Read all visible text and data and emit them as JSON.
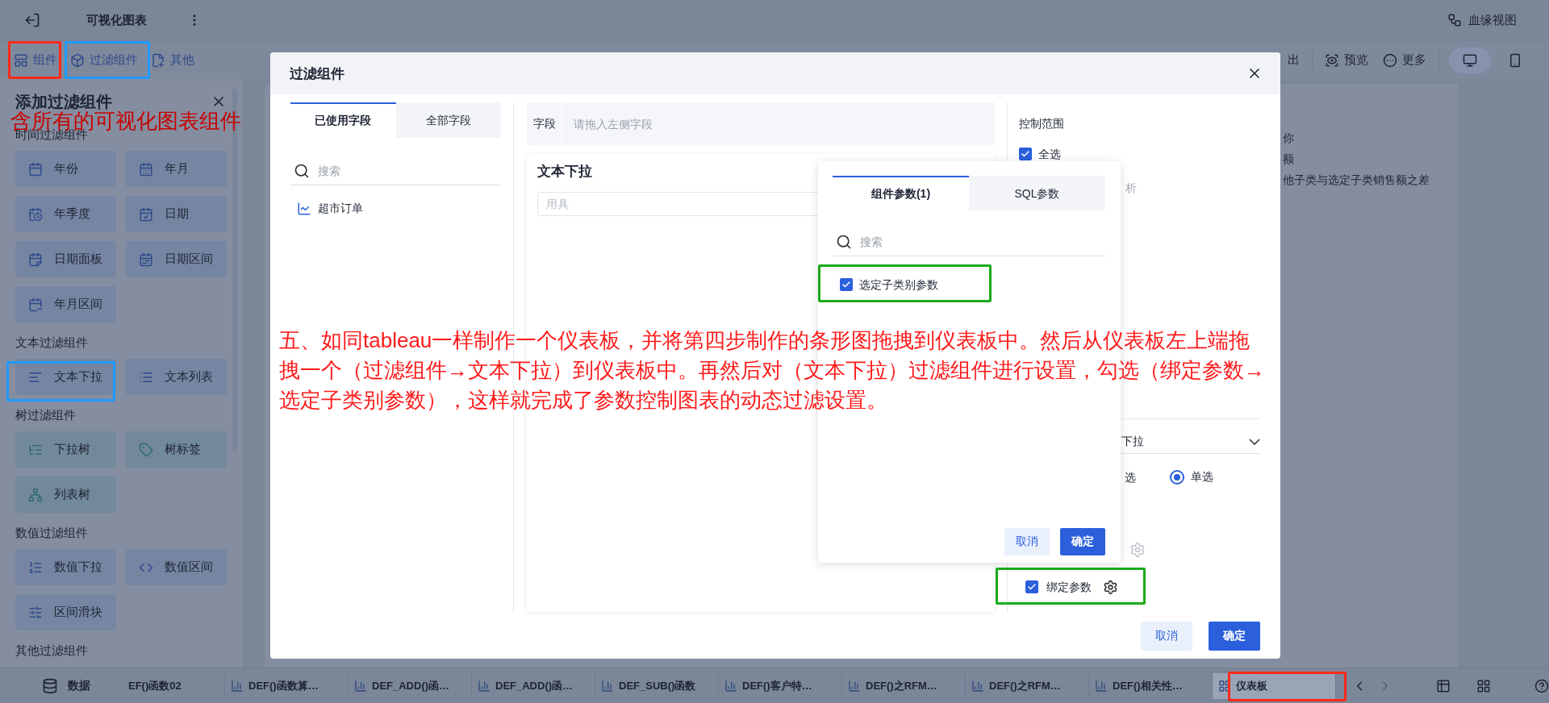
{
  "top_bar": {
    "title": "可视化图表",
    "lineage_link": "血缘视图"
  },
  "toolbar": {
    "left": [
      {
        "label": "组件",
        "kind": "widget"
      },
      {
        "label": "过滤组件",
        "kind": "filter"
      },
      {
        "label": "其他",
        "kind": "other"
      }
    ],
    "right": [
      {
        "label": "出",
        "kind": "export"
      },
      {
        "label": "预览",
        "kind": "preview"
      },
      {
        "label": "更多",
        "kind": "more"
      }
    ],
    "view_modes": [
      {
        "kind": "desktop",
        "selected": true
      },
      {
        "kind": "mobile",
        "selected": false
      }
    ]
  },
  "left_panel": {
    "title": "添加过滤组件",
    "sections": [
      {
        "title": "时间过滤组件",
        "kind": "time",
        "items": [
          {
            "label": "年份",
            "kind": "year"
          },
          {
            "label": "年月",
            "kind": "month"
          },
          {
            "label": "年季度",
            "kind": "quarter"
          },
          {
            "label": "日期",
            "kind": "date"
          },
          {
            "label": "日期面板",
            "kind": "date_panel"
          },
          {
            "label": "日期区间",
            "kind": "date_range"
          },
          {
            "label": "年月区间",
            "kind": "month_range"
          }
        ]
      },
      {
        "title": "文本过滤组件",
        "kind": "text",
        "items": [
          {
            "label": "文本下拉",
            "kind": "text_dropdown"
          },
          {
            "label": "文本列表",
            "kind": "text_list"
          }
        ]
      },
      {
        "title": "树过滤组件",
        "kind": "tree",
        "items": [
          {
            "label": "下拉树",
            "kind": "tree_dropdown"
          },
          {
            "label": "树标签",
            "kind": "tree_tag"
          },
          {
            "label": "列表树",
            "kind": "list_tree"
          }
        ]
      },
      {
        "title": "数值过滤组件",
        "kind": "number",
        "items": [
          {
            "label": "数值下拉",
            "kind": "number_dropdown"
          },
          {
            "label": "数值区间",
            "kind": "number_range"
          },
          {
            "label": "区间滑块",
            "kind": "range_slider"
          }
        ]
      },
      {
        "title": "其他过滤组件"
      }
    ]
  },
  "canvas_text": [
    "你",
    "额",
    "他子类与选定子类销售额之差"
  ],
  "modal": {
    "title": "过滤组件",
    "field_tabs": [
      {
        "label": "已使用字段",
        "selected": true
      },
      {
        "label": "全部字段",
        "selected": false
      }
    ],
    "field_search": {
      "placeholder": "搜索"
    },
    "datasets": [
      {
        "label": "超市订单"
      }
    ],
    "field_slot": {
      "label": "字段",
      "placeholder": "请拖入左侧字段"
    },
    "preview": {
      "title": "文本下拉",
      "placeholder": "用具"
    },
    "settings": {
      "scope_label": "控制范围",
      "select_all": {
        "label": "全选",
        "checked": true
      },
      "hint": "析",
      "display_type": "下拉",
      "partial_option": "选",
      "radio": {
        "label": "单选",
        "selected": true
      },
      "bind_param": {
        "label": "绑定参数",
        "checked": true
      }
    },
    "buttons": [
      {
        "label": "取消",
        "kind": "secondary"
      },
      {
        "label": "确定",
        "kind": "primary"
      }
    ]
  },
  "popup": {
    "tabs": [
      {
        "label": "组件参数(1)",
        "selected": true
      },
      {
        "label": "SQL参数",
        "selected": false
      }
    ],
    "search": {
      "placeholder": "搜索"
    },
    "params": [
      {
        "label": "选定子类别参数",
        "checked": true
      }
    ],
    "buttons": [
      {
        "label": "取消",
        "kind": "secondary"
      },
      {
        "label": "确定",
        "kind": "primary"
      }
    ]
  },
  "bottom_bar": {
    "data_tab": "数据",
    "sheets": [
      {
        "label": "EF()函数02",
        "kind": "label_only",
        "selected": false
      },
      {
        "label": "DEF()函数算…",
        "kind": "worksheet",
        "selected": false
      },
      {
        "label": "DEF_ADD()函…",
        "kind": "worksheet",
        "selected": false
      },
      {
        "label": "DEF_ADD()函…",
        "kind": "worksheet",
        "selected": false
      },
      {
        "label": "DEF_SUB()函数",
        "kind": "worksheet",
        "selected": false
      },
      {
        "label": "DEF()客户特…",
        "kind": "worksheet",
        "selected": false
      },
      {
        "label": "DEF()之RFM…",
        "kind": "worksheet",
        "selected": false
      },
      {
        "label": "DEF()之RFM…",
        "kind": "worksheet",
        "selected": false
      },
      {
        "label": "DEF()相关性…",
        "kind": "worksheet",
        "selected": false
      },
      {
        "label": "仪表板",
        "kind": "dashboard",
        "selected": true
      }
    ]
  },
  "annotations": {
    "caption": "含所有的可视化图表组件",
    "note_lines": [
      "五、如同tableau一样制作一个仪表板，并将第四步制作的条形图拖拽到仪表板中。然后从仪表板左上端拖",
      "拽一个（过滤组件→文本下拉）到仪表板中。再然后对（文本下拉）过滤组件进行设置，勾选（绑定参数→",
      "选定子类别参数），这样就完成了参数控制图表的动态过滤设置。"
    ]
  }
}
